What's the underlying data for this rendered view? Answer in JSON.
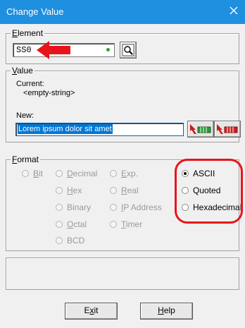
{
  "window": {
    "title": "Change Value"
  },
  "element": {
    "legend_first": "E",
    "legend_rest": "lement",
    "value": "SS0"
  },
  "value_group": {
    "legend_first": "V",
    "legend_rest": "alue",
    "current_label": "Current:",
    "current_value": "<empty-string>",
    "new_label": "New:",
    "new_value": "Lorem ipsum dolor sit amet"
  },
  "format": {
    "legend_first": "F",
    "legend_rest": "ormat",
    "options": {
      "bit": {
        "first": "B",
        "rest": "it",
        "selected": false,
        "enabled": false
      },
      "decimal": {
        "first": "D",
        "rest": "ecimal",
        "selected": false,
        "enabled": false
      },
      "hex": {
        "first": "H",
        "rest": "ex",
        "selected": false,
        "enabled": false
      },
      "binary": {
        "first": "",
        "rest": "Binary",
        "selected": false,
        "enabled": false
      },
      "octal": {
        "first": "O",
        "rest": "ctal",
        "selected": false,
        "enabled": false
      },
      "bcd": {
        "first": "",
        "rest": "BCD",
        "selected": false,
        "enabled": false
      },
      "exp": {
        "first": "E",
        "rest": "xp.",
        "selected": false,
        "enabled": false
      },
      "real": {
        "first": "R",
        "rest": "eal",
        "selected": false,
        "enabled": false
      },
      "ip": {
        "first": "I",
        "rest": "P Address",
        "selected": false,
        "enabled": false
      },
      "timer": {
        "first": "T",
        "rest": "imer",
        "selected": false,
        "enabled": false
      },
      "ascii": {
        "label": "ASCII",
        "selected": true,
        "enabled": true
      },
      "quoted": {
        "label": "Quoted",
        "selected": false,
        "enabled": true
      },
      "hexadecimal": {
        "label": "Hexadecimal",
        "selected": false,
        "enabled": true
      }
    }
  },
  "buttons": {
    "exit_pre": "E",
    "exit_u": "x",
    "exit_post": "it",
    "help_u": "H",
    "help_rest": "elp"
  },
  "colors": {
    "titlebar": "#1f8fe0",
    "annotation": "#e8141a",
    "selection": "#0078d7",
    "status_led": "#2ea02e"
  }
}
